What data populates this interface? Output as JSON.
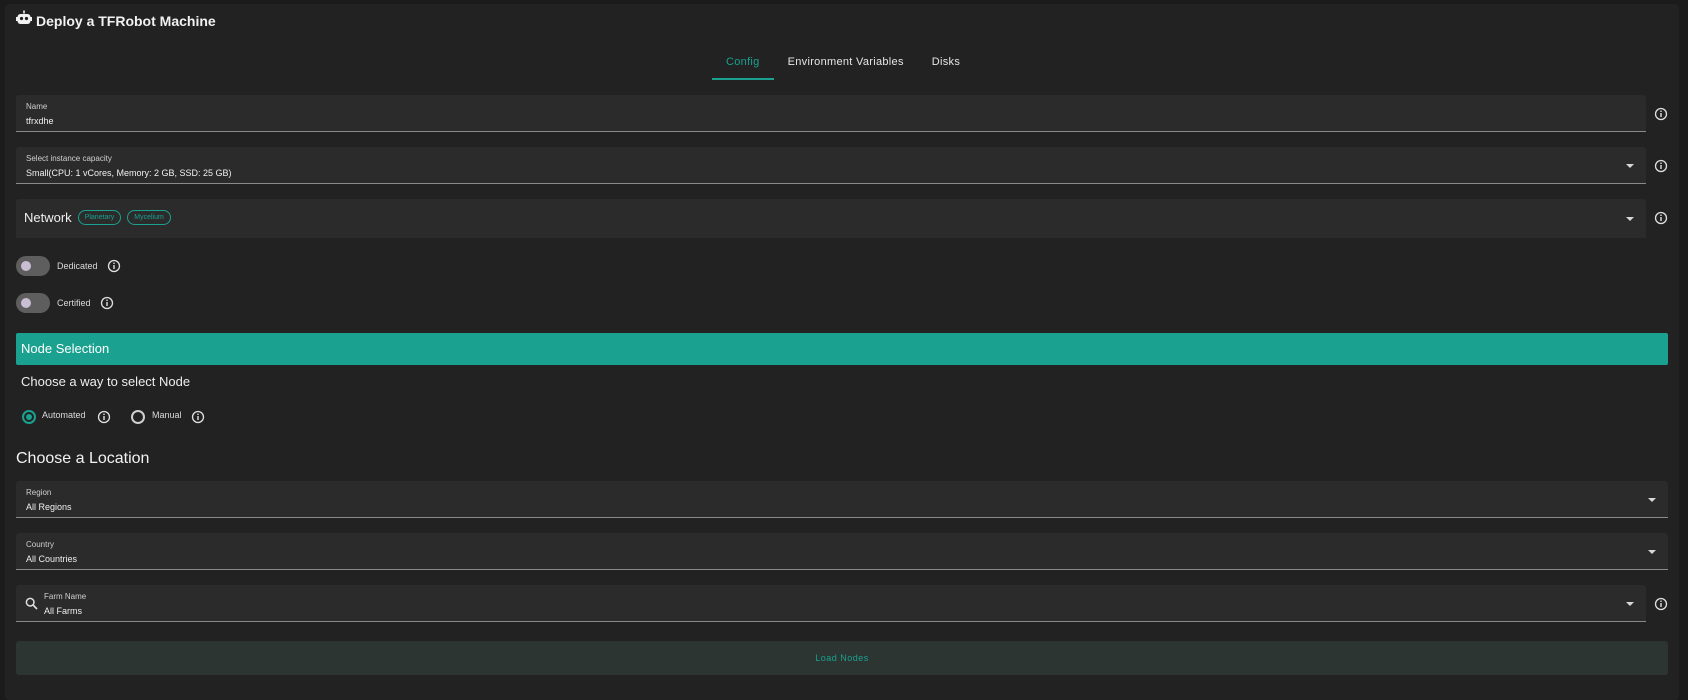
{
  "header": {
    "title": "Deploy a TFRobot Machine",
    "icon": "robot-icon"
  },
  "tabs": [
    {
      "label": "Config",
      "active": true
    },
    {
      "label": "Environment Variables",
      "active": false
    },
    {
      "label": "Disks",
      "active": false
    }
  ],
  "name_field": {
    "label": "Name",
    "value": "tfrxdhe"
  },
  "capacity_field": {
    "label": "Select instance capacity",
    "value": "Small(CPU: 1 vCores, Memory: 2 GB, SSD: 25 GB)"
  },
  "network": {
    "label": "Network",
    "chips": [
      "Planetary",
      "Mycelium"
    ]
  },
  "toggles": {
    "dedicated": "Dedicated",
    "certified": "Certified"
  },
  "node_selection": {
    "header": "Node Selection",
    "prompt": "Choose a way to select Node",
    "options": {
      "automated": "Automated",
      "manual": "Manual"
    },
    "selected": "Automated"
  },
  "location": {
    "heading": "Choose a Location",
    "region": {
      "label": "Region",
      "value": "All Regions"
    },
    "country": {
      "label": "Country",
      "value": "All Countries"
    },
    "farm": {
      "label": "Farm Name",
      "value": "All Farms"
    }
  },
  "load_button": "Load Nodes",
  "colors": {
    "accent": "#1aa18f",
    "background": "#222222",
    "field": "#2b2b2b"
  }
}
